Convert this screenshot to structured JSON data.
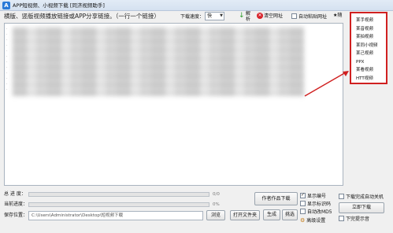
{
  "window": {
    "title": "APP短视频、小视频下载 [同济视频助手]",
    "app_icon_glyph": "A"
  },
  "toolbar": {
    "instruction": "横版、竖版视频播放链接或APP分享链接。（一行一个链接）",
    "speed_label": "下载速度：",
    "speed_value": "快",
    "parse_label": "解析",
    "clear_label": "清空网址",
    "auto_paste_label": "自动粘贴网址",
    "random_label": "随"
  },
  "platform_menu": {
    "items": [
      "某手视频",
      "某音视频",
      "某拍视频",
      "某同小视频",
      "某己视频",
      "PPX",
      "某看视频",
      "HTT视频"
    ]
  },
  "progress": {
    "total_label": "总 进 度：",
    "total_value": "0/0",
    "current_label": "当前进度：",
    "current_value": "0%"
  },
  "save": {
    "label": "保存位置：",
    "path": "C:\\Users\\Administrator\\Desktop\\短视频下载",
    "browse_label": "浏览",
    "open_folder_label": "打开文件夹",
    "generate_label": "生成",
    "pick_label": "挑选"
  },
  "actions": {
    "author_download_label": "作者作品下载",
    "start_download_label": "立即下载"
  },
  "options": {
    "show_number": {
      "label": "显示编号",
      "checked": true
    },
    "show_id": {
      "label": "显示标识码",
      "checked": false
    },
    "auto_md5": {
      "label": "自动改MD5",
      "checked": false
    },
    "advanced": {
      "label": "高级设置"
    },
    "auto_shutdown": {
      "label": "下载完成自动关机",
      "checked": false
    },
    "done_wait": {
      "label": "下完提示音",
      "checked": false
    }
  },
  "colors": {
    "menu_border": "#d02020",
    "arrow": "#d02020",
    "clear_icon": "#d8232a",
    "parse_icon": "#2a9b2a"
  }
}
